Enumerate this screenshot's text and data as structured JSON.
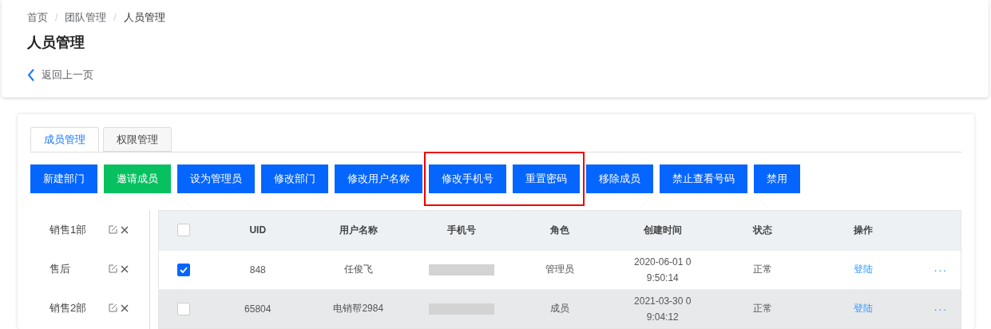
{
  "breadcrumb": [
    "首页",
    "团队管理",
    "人员管理"
  ],
  "breadcrumb_separator": "/",
  "page_title": "人员管理",
  "back_link": "返回上一页",
  "tabs": [
    {
      "label": "成员管理",
      "selected": true
    },
    {
      "label": "权限管理",
      "selected": false
    }
  ],
  "actions": [
    {
      "label": "新建部门",
      "kind": "primary",
      "highlighted": false
    },
    {
      "label": "邀请成员",
      "kind": "success",
      "highlighted": false
    },
    {
      "label": "设为管理员",
      "kind": "primary",
      "highlighted": false
    },
    {
      "label": "修改部门",
      "kind": "primary",
      "highlighted": false
    },
    {
      "label": "修改用户名称",
      "kind": "primary",
      "highlighted": false
    },
    {
      "label": "修改手机号",
      "kind": "primary",
      "highlighted": true
    },
    {
      "label": "重置密码",
      "kind": "primary",
      "highlighted": true
    },
    {
      "label": "移除成员",
      "kind": "primary",
      "highlighted": false
    },
    {
      "label": "禁止查看号码",
      "kind": "primary",
      "highlighted": false
    },
    {
      "label": "禁用",
      "kind": "primary",
      "highlighted": false
    }
  ],
  "departments": [
    "销售1部",
    "售后",
    "销售2部"
  ],
  "table": {
    "header_checked": false,
    "columns": [
      "UID",
      "用户名称",
      "手机号",
      "角色",
      "创建时间",
      "状态",
      "操作"
    ],
    "rows": [
      {
        "checked": true,
        "hovered": false,
        "uid": "848",
        "name": "任俊飞",
        "role": "管理员",
        "created": "2020-06-01 09:50:14",
        "status": "正常",
        "action": "登陆",
        "more": "···"
      },
      {
        "checked": false,
        "hovered": true,
        "uid": "65804",
        "name": "电销帮2984",
        "role": "成员",
        "created": "2021-03-30 09:04:12",
        "status": "正常",
        "action": "登陆",
        "more": "···"
      }
    ]
  }
}
